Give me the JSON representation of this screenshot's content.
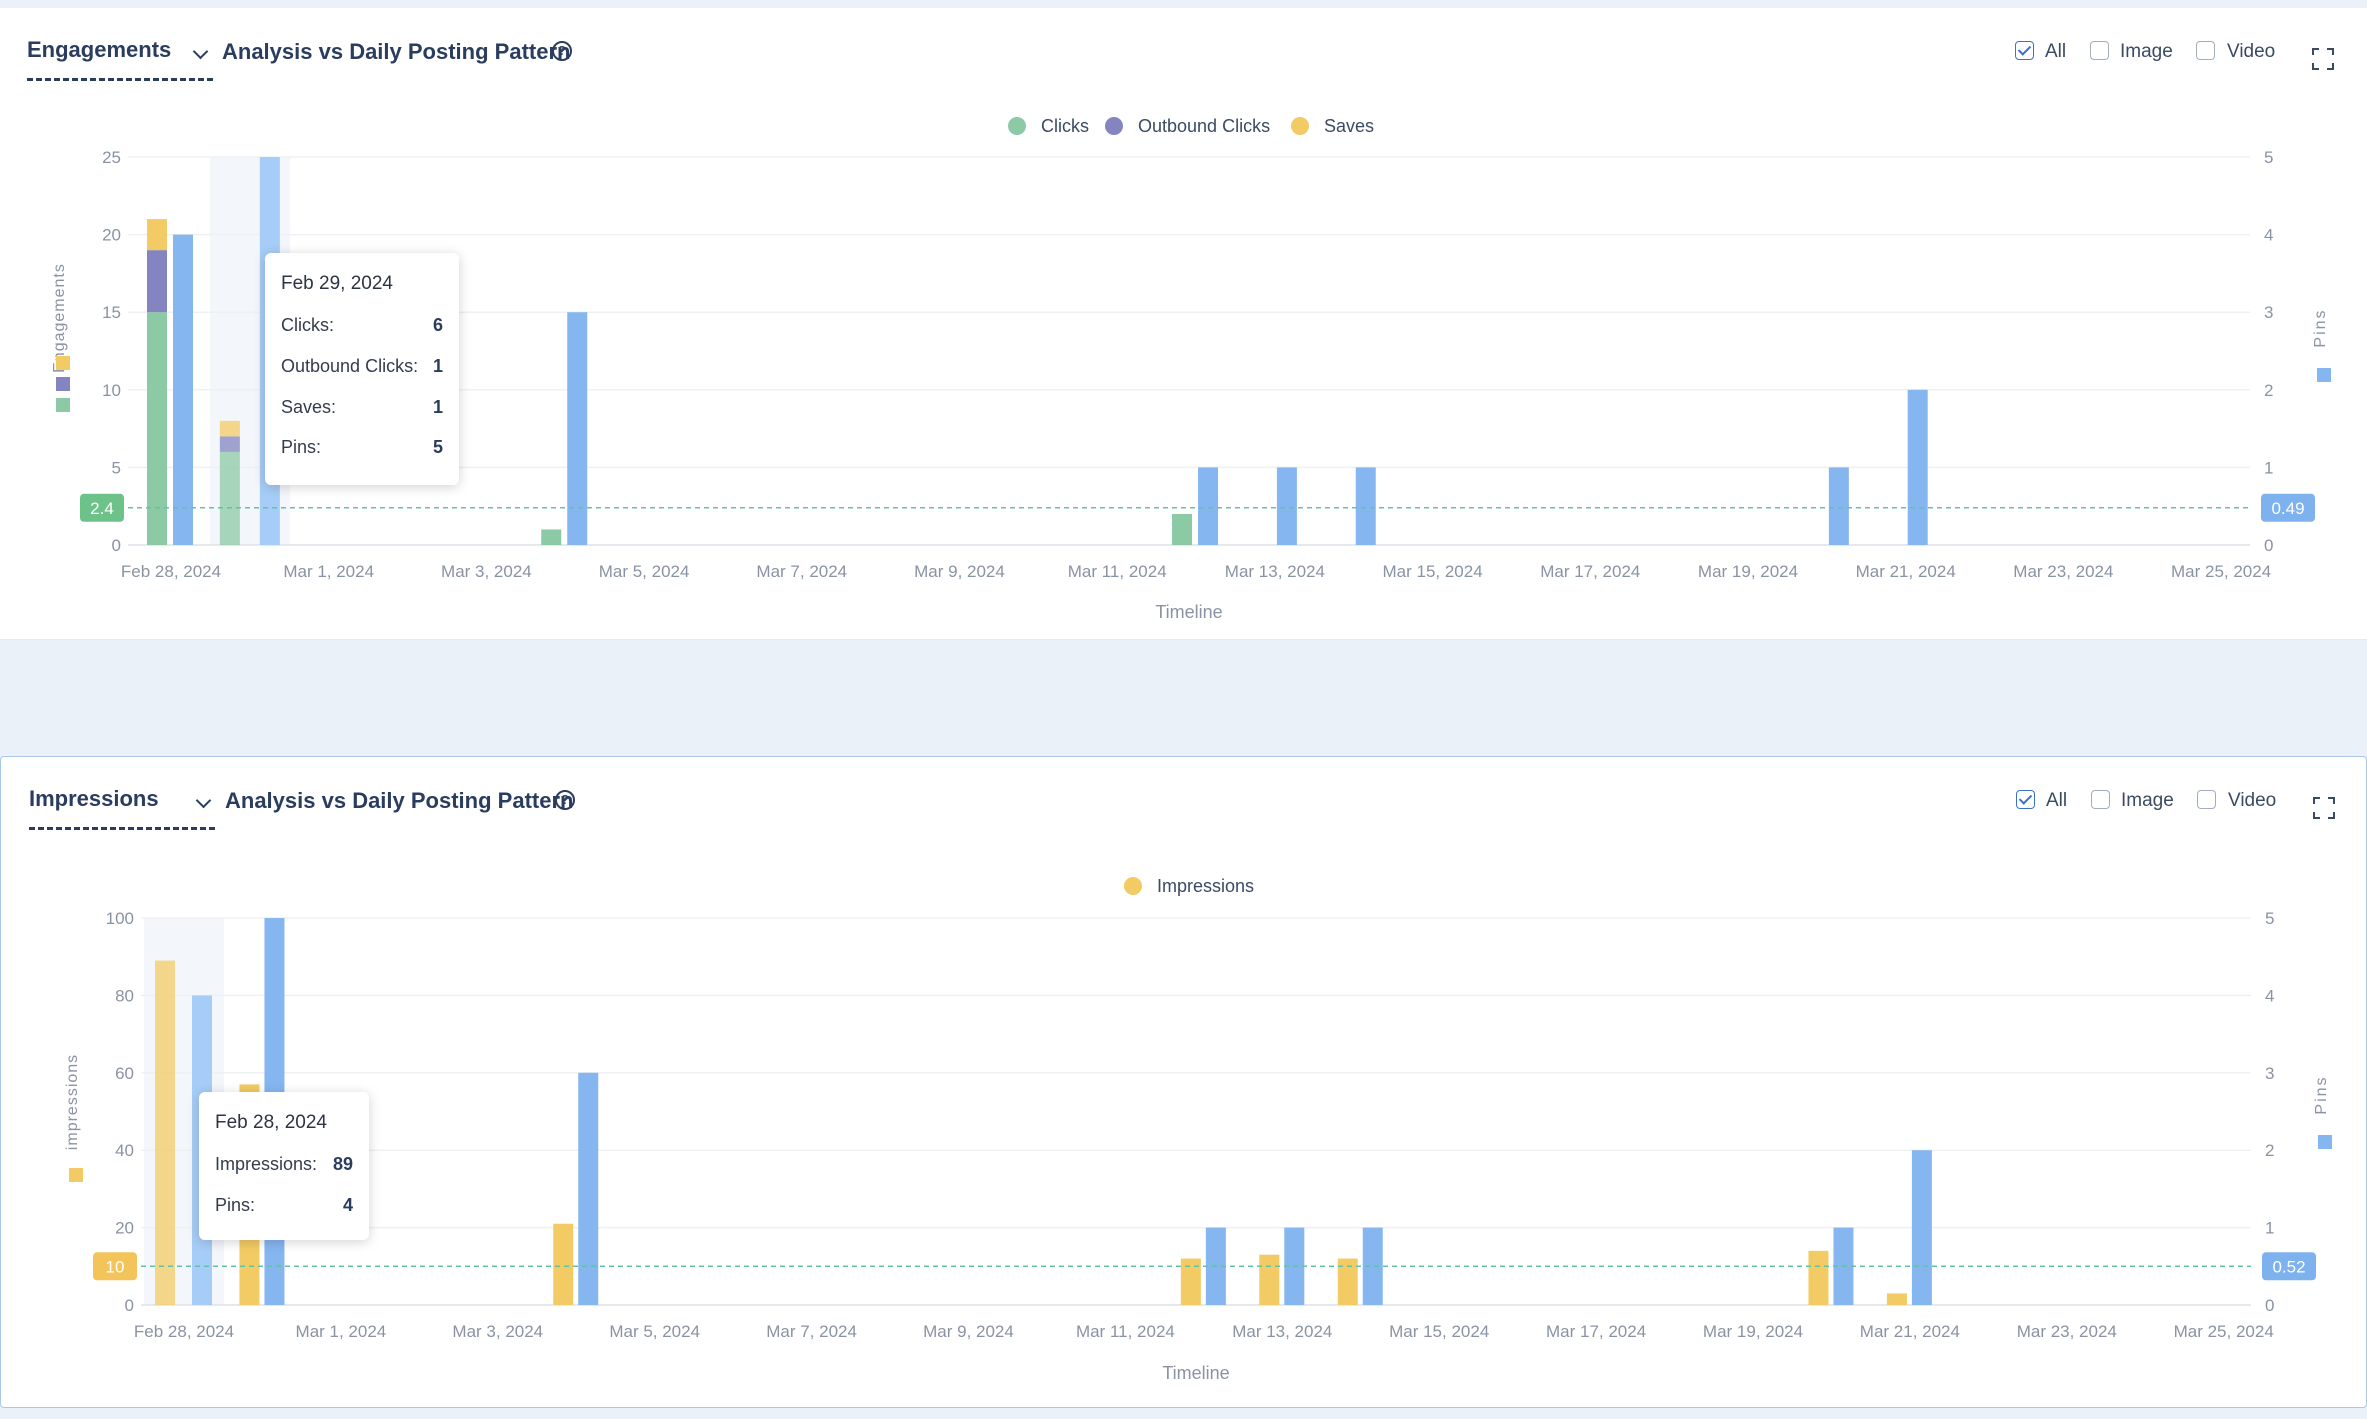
{
  "panels": [
    {
      "metric": "Engagements",
      "title": "Analysis vs Daily Posting Pattern",
      "filters": [
        {
          "label": "All",
          "checked": true
        },
        {
          "label": "Image",
          "checked": false
        },
        {
          "label": "Video",
          "checked": false
        }
      ],
      "tooltip": {
        "date": "Feb 29, 2024",
        "rows": [
          {
            "label": "Clicks:",
            "value": "6"
          },
          {
            "label": "Outbound Clicks:",
            "value": "1"
          },
          {
            "label": "Saves:",
            "value": "1"
          },
          {
            "label": "Pins:",
            "value": "5"
          }
        ]
      }
    },
    {
      "metric": "Impressions",
      "title": "Analysis vs Daily Posting Pattern",
      "filters": [
        {
          "label": "All",
          "checked": true
        },
        {
          "label": "Image",
          "checked": false
        },
        {
          "label": "Video",
          "checked": false
        }
      ],
      "tooltip": {
        "date": "Feb 28, 2024",
        "rows": [
          {
            "label": "Impressions:",
            "value": "89"
          },
          {
            "label": "Pins:",
            "value": "4"
          }
        ]
      }
    }
  ],
  "chart_data": [
    {
      "type": "bar",
      "x_dates": [
        "Feb 28, 2024",
        "Feb 29, 2024",
        "Mar 1, 2024",
        "Mar 2, 2024",
        "Mar 3, 2024",
        "Mar 4, 2024",
        "Mar 5, 2024",
        "Mar 6, 2024",
        "Mar 7, 2024",
        "Mar 8, 2024",
        "Mar 9, 2024",
        "Mar 10, 2024",
        "Mar 11, 2024",
        "Mar 12, 2024",
        "Mar 13, 2024",
        "Mar 14, 2024",
        "Mar 15, 2024",
        "Mar 16, 2024",
        "Mar 17, 2024",
        "Mar 18, 2024",
        "Mar 19, 2024",
        "Mar 20, 2024",
        "Mar 21, 2024",
        "Mar 22, 2024",
        "Mar 23, 2024",
        "Mar 24, 2024",
        "Mar 25, 2024"
      ],
      "x_ticks": [
        "Feb 28, 2024",
        "Mar 1, 2024",
        "Mar 3, 2024",
        "Mar 5, 2024",
        "Mar 7, 2024",
        "Mar 9, 2024",
        "Mar 11, 2024",
        "Mar 13, 2024",
        "Mar 15, 2024",
        "Mar 17, 2024",
        "Mar 19, 2024",
        "Mar 21, 2024",
        "Mar 23, 2024",
        "Mar 25, 2024"
      ],
      "xlabel": "Timeline",
      "ylabel_left": "Engagements",
      "ylabel_right": "Pins",
      "ylim_left": [
        0,
        25
      ],
      "ylim_right": [
        0,
        5
      ],
      "y_ticks_left": [
        "0",
        "5",
        "10",
        "15",
        "20",
        "25"
      ],
      "y_ticks_right": [
        "0",
        "1",
        "2",
        "3",
        "4",
        "5"
      ],
      "legend_position": "top-center",
      "stack_series": [
        {
          "name": "Clicks",
          "color": "#8cc9a5",
          "values": [
            15,
            6,
            0,
            0,
            0,
            1,
            0,
            0,
            0,
            0,
            0,
            0,
            0,
            2,
            0,
            0,
            0,
            0,
            0,
            0,
            0,
            0,
            0,
            0,
            0,
            0,
            0
          ]
        },
        {
          "name": "Outbound Clicks",
          "color": "#8384c0",
          "values": [
            4,
            1,
            0,
            0,
            0,
            0,
            0,
            0,
            0,
            0,
            0,
            0,
            0,
            0,
            0,
            0,
            0,
            0,
            0,
            0,
            0,
            0,
            0,
            0,
            0,
            0,
            0
          ]
        },
        {
          "name": "Saves",
          "color": "#f3cb64",
          "values": [
            2,
            1,
            0,
            0,
            0,
            0,
            0,
            0,
            0,
            0,
            0,
            0,
            0,
            0,
            0,
            0,
            0,
            0,
            0,
            0,
            0,
            0,
            0,
            0,
            0,
            0,
            0
          ]
        }
      ],
      "pins_series": {
        "name": "Pins",
        "color": "#85b6f0",
        "values": [
          4,
          5,
          0,
          0,
          0,
          3,
          0,
          0,
          0,
          0,
          0,
          0,
          0,
          1,
          1,
          1,
          0,
          0,
          0,
          0,
          0,
          1,
          2,
          0,
          0,
          0,
          0
        ]
      },
      "avg_left": 2.4,
      "avg_right": 0.49,
      "highlight_index": 1
    },
    {
      "type": "bar",
      "x_dates": [
        "Feb 28, 2024",
        "Feb 29, 2024",
        "Mar 1, 2024",
        "Mar 2, 2024",
        "Mar 3, 2024",
        "Mar 4, 2024",
        "Mar 5, 2024",
        "Mar 6, 2024",
        "Mar 7, 2024",
        "Mar 8, 2024",
        "Mar 9, 2024",
        "Mar 10, 2024",
        "Mar 11, 2024",
        "Mar 12, 2024",
        "Mar 13, 2024",
        "Mar 14, 2024",
        "Mar 15, 2024",
        "Mar 16, 2024",
        "Mar 17, 2024",
        "Mar 18, 2024",
        "Mar 19, 2024",
        "Mar 20, 2024",
        "Mar 21, 2024",
        "Mar 22, 2024",
        "Mar 23, 2024",
        "Mar 24, 2024",
        "Mar 25, 2024"
      ],
      "x_ticks": [
        "Feb 28, 2024",
        "Mar 1, 2024",
        "Mar 3, 2024",
        "Mar 5, 2024",
        "Mar 7, 2024",
        "Mar 9, 2024",
        "Mar 11, 2024",
        "Mar 13, 2024",
        "Mar 15, 2024",
        "Mar 17, 2024",
        "Mar 19, 2024",
        "Mar 21, 2024",
        "Mar 23, 2024",
        "Mar 25, 2024"
      ],
      "xlabel": "Timeline",
      "ylabel_left": "impressions",
      "ylabel_right": "Pins",
      "ylim_left": [
        0,
        100
      ],
      "ylim_right": [
        0,
        5
      ],
      "y_ticks_left": [
        "0",
        "20",
        "40",
        "60",
        "80",
        "100"
      ],
      "y_ticks_right": [
        "0",
        "1",
        "2",
        "3",
        "4",
        "5"
      ],
      "legend_position": "top-center",
      "stack_series": [
        {
          "name": "Impressions",
          "color": "#f3cb64",
          "values": [
            89,
            57,
            0,
            0,
            0,
            21,
            0,
            0,
            0,
            0,
            0,
            0,
            0,
            12,
            13,
            12,
            0,
            0,
            0,
            0,
            0,
            14,
            3,
            0,
            0,
            0,
            0
          ]
        }
      ],
      "pins_series": {
        "name": "Pins",
        "color": "#85b6f0",
        "values": [
          4,
          5,
          0,
          0,
          0,
          3,
          0,
          0,
          0,
          0,
          0,
          0,
          0,
          1,
          1,
          1,
          0,
          0,
          0,
          0,
          0,
          1,
          2,
          0,
          0,
          0,
          0
        ]
      },
      "avg_left": 10,
      "avg_right": 0.52,
      "highlight_index": 0
    }
  ]
}
